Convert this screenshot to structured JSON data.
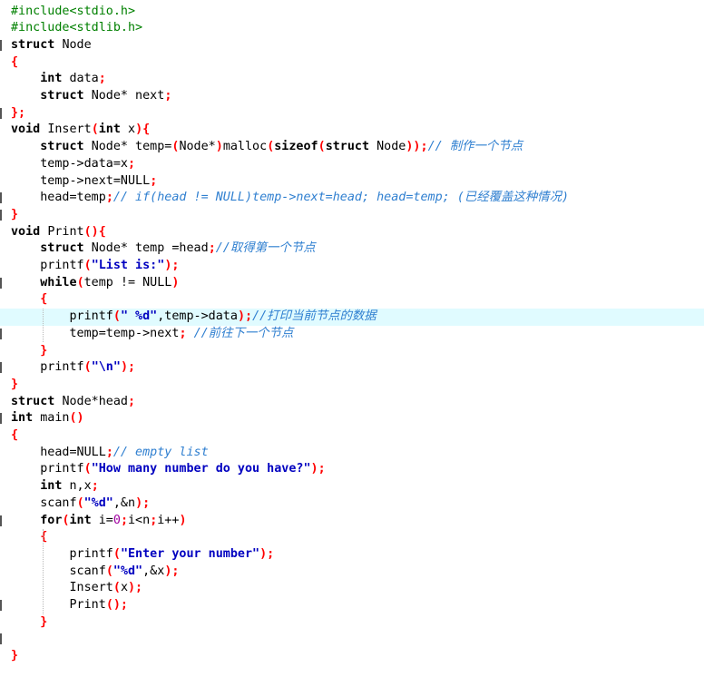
{
  "editor": {
    "language": "C",
    "highlighted_line": 19,
    "colors": {
      "background": "#ffffff",
      "highlight": "#e0fbff",
      "keyword": "#000000",
      "punctuation": "#ff0000",
      "string": "#0000c0",
      "comment": "#2f7fd0",
      "preprocessor": "#008000"
    },
    "lines": [
      [
        [
          "pp",
          "#include<stdio.h>"
        ]
      ],
      [
        [
          "pp",
          "#include<stdlib.h>"
        ]
      ],
      [
        [
          "kb",
          "struct "
        ],
        [
          "id",
          "Node"
        ]
      ],
      [
        [
          "pn",
          "{"
        ]
      ],
      [
        [
          "id",
          "    "
        ],
        [
          "kb",
          "int "
        ],
        [
          "id",
          "data"
        ],
        [
          "pn",
          ";"
        ]
      ],
      [
        [
          "id",
          "    "
        ],
        [
          "kb",
          "struct "
        ],
        [
          "id",
          "Node* next"
        ],
        [
          "pn",
          ";"
        ]
      ],
      [
        [
          "pn",
          "};"
        ]
      ],
      [
        [
          "kb",
          "void "
        ],
        [
          "id",
          "Insert"
        ],
        [
          "pn",
          "("
        ],
        [
          "kb",
          "int "
        ],
        [
          "id",
          "x"
        ],
        [
          "pn",
          "){"
        ]
      ],
      [
        [
          "id",
          "    "
        ],
        [
          "kb",
          "struct "
        ],
        [
          "id",
          "Node* temp="
        ],
        [
          "pn",
          "("
        ],
        [
          "id",
          "Node*"
        ],
        [
          "pn",
          ")"
        ],
        [
          "id",
          "malloc"
        ],
        [
          "pn",
          "("
        ],
        [
          "kb",
          "sizeof"
        ],
        [
          "pn",
          "("
        ],
        [
          "kb",
          "struct "
        ],
        [
          "id",
          "Node"
        ],
        [
          "pn",
          "));"
        ],
        [
          "cm",
          "// 制作一个节点"
        ]
      ],
      [
        [
          "id",
          "    temp->data=x"
        ],
        [
          "pn",
          ";"
        ]
      ],
      [
        [
          "id",
          "    temp->next=NULL"
        ],
        [
          "pn",
          ";"
        ]
      ],
      [
        [
          "id",
          "    head=temp"
        ],
        [
          "pn",
          ";"
        ],
        [
          "cm",
          "// if(head != NULL)temp->next=head; head=temp; (已经覆盖这种情况)"
        ]
      ],
      [
        [
          "pn",
          "}"
        ]
      ],
      [
        [
          "kb",
          "void "
        ],
        [
          "id",
          "Print"
        ],
        [
          "pn",
          "(){"
        ]
      ],
      [
        [
          "id",
          "    "
        ],
        [
          "kb",
          "struct "
        ],
        [
          "id",
          "Node* temp =head"
        ],
        [
          "pn",
          ";"
        ],
        [
          "cm",
          "//取得第一个节点"
        ]
      ],
      [
        [
          "id",
          "    printf"
        ],
        [
          "pn",
          "("
        ],
        [
          "st",
          "\"List is:\""
        ],
        [
          "pn",
          ");"
        ]
      ],
      [
        [
          "id",
          "    "
        ],
        [
          "kb",
          "while"
        ],
        [
          "pn",
          "("
        ],
        [
          "id",
          "temp != NULL"
        ],
        [
          "pn",
          ")"
        ]
      ],
      [
        [
          "id",
          "    "
        ],
        [
          "pn",
          "{"
        ]
      ],
      [
        [
          "id",
          "        printf"
        ],
        [
          "pn",
          "("
        ],
        [
          "st",
          "\" %d\""
        ],
        [
          "id",
          ",temp->data"
        ],
        [
          "pn",
          ");"
        ],
        [
          "cm",
          "//打印当前节点的数据"
        ]
      ],
      [
        [
          "id",
          "        temp=temp->next"
        ],
        [
          "pn",
          "; "
        ],
        [
          "cm",
          "//前往下一个节点"
        ]
      ],
      [
        [
          "id",
          "    "
        ],
        [
          "pn",
          "}"
        ]
      ],
      [
        [
          "id",
          "    printf"
        ],
        [
          "pn",
          "("
        ],
        [
          "st",
          "\"\\n\""
        ],
        [
          "pn",
          ");"
        ]
      ],
      [
        [
          "pn",
          "}"
        ]
      ],
      [
        [
          "kb",
          "struct "
        ],
        [
          "id",
          "Node*head"
        ],
        [
          "pn",
          ";"
        ]
      ],
      [
        [
          "kb",
          "int "
        ],
        [
          "id",
          "main"
        ],
        [
          "pn",
          "()"
        ]
      ],
      [
        [
          "pn",
          "{"
        ]
      ],
      [
        [
          "id",
          "    head=NULL"
        ],
        [
          "pn",
          ";"
        ],
        [
          "cm",
          "// empty list"
        ]
      ],
      [
        [
          "id",
          "    printf"
        ],
        [
          "pn",
          "("
        ],
        [
          "st",
          "\"How many number do you have?\""
        ],
        [
          "pn",
          ");"
        ]
      ],
      [
        [
          "id",
          "    "
        ],
        [
          "kb",
          "int "
        ],
        [
          "id",
          "n,x"
        ],
        [
          "pn",
          ";"
        ]
      ],
      [
        [
          "id",
          "    scanf"
        ],
        [
          "pn",
          "("
        ],
        [
          "st",
          "\"%d\""
        ],
        [
          "id",
          ",&n"
        ],
        [
          "pn",
          ");"
        ]
      ],
      [
        [
          "id",
          "    "
        ],
        [
          "kb",
          "for"
        ],
        [
          "pn",
          "("
        ],
        [
          "kb",
          "int "
        ],
        [
          "id",
          "i="
        ],
        [
          "nu",
          "0"
        ],
        [
          "pn",
          ";"
        ],
        [
          "id",
          "i<n"
        ],
        [
          "pn",
          ";"
        ],
        [
          "id",
          "i++"
        ],
        [
          "pn",
          ")"
        ]
      ],
      [
        [
          "id",
          "    "
        ],
        [
          "pn",
          "{"
        ]
      ],
      [
        [
          "id",
          "        printf"
        ],
        [
          "pn",
          "("
        ],
        [
          "st",
          "\"Enter your number\""
        ],
        [
          "pn",
          ");"
        ]
      ],
      [
        [
          "id",
          "        scanf"
        ],
        [
          "pn",
          "("
        ],
        [
          "st",
          "\"%d\""
        ],
        [
          "id",
          ",&x"
        ],
        [
          "pn",
          ");"
        ]
      ],
      [
        [
          "id",
          "        Insert"
        ],
        [
          "pn",
          "("
        ],
        [
          "id",
          "x"
        ],
        [
          "pn",
          ");"
        ]
      ],
      [
        [
          "id",
          "        Print"
        ],
        [
          "pn",
          "();"
        ]
      ],
      [
        [
          "id",
          "    "
        ],
        [
          "pn",
          "}"
        ]
      ],
      [
        [
          "id",
          ""
        ]
      ],
      [
        [
          "pn",
          "}"
        ]
      ]
    ],
    "markers": [
      3,
      7,
      12,
      13,
      17,
      20,
      22,
      25,
      31,
      36,
      38
    ]
  }
}
